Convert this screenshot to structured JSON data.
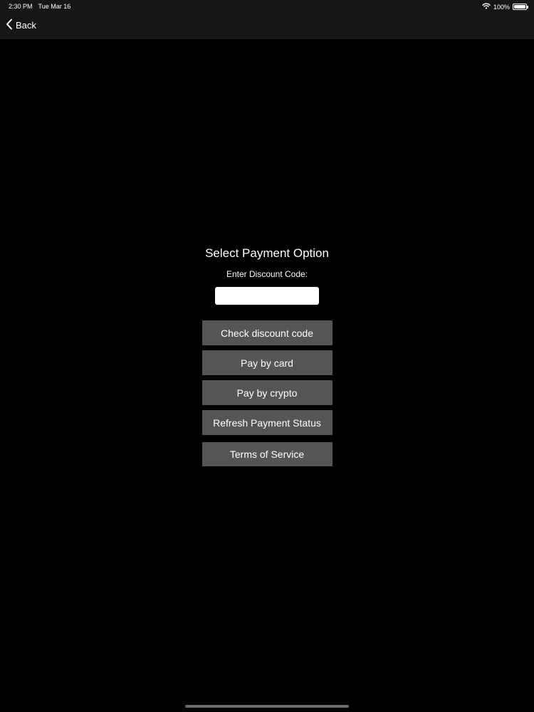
{
  "status_bar": {
    "time": "2:30 PM",
    "date": "Tue Mar 16",
    "battery_percent": "100%",
    "battery_level": 1.0,
    "wifi_icon": "wifi-icon",
    "battery_icon": "battery-icon"
  },
  "nav": {
    "back_label": "Back",
    "back_icon": "chevron-left-icon"
  },
  "main": {
    "title": "Select Payment Option",
    "discount_label": "Enter Discount Code:",
    "discount_value": "",
    "buttons": {
      "check_discount": "Check discount code",
      "pay_card": "Pay by card",
      "pay_crypto": "Pay by crypto",
      "refresh_status": "Refresh Payment Status",
      "terms": "Terms of Service"
    }
  },
  "colors": {
    "background": "#000000",
    "top_bar": "#161616",
    "button": "#555555",
    "text": "#ffffff",
    "input": "#ffffff"
  }
}
